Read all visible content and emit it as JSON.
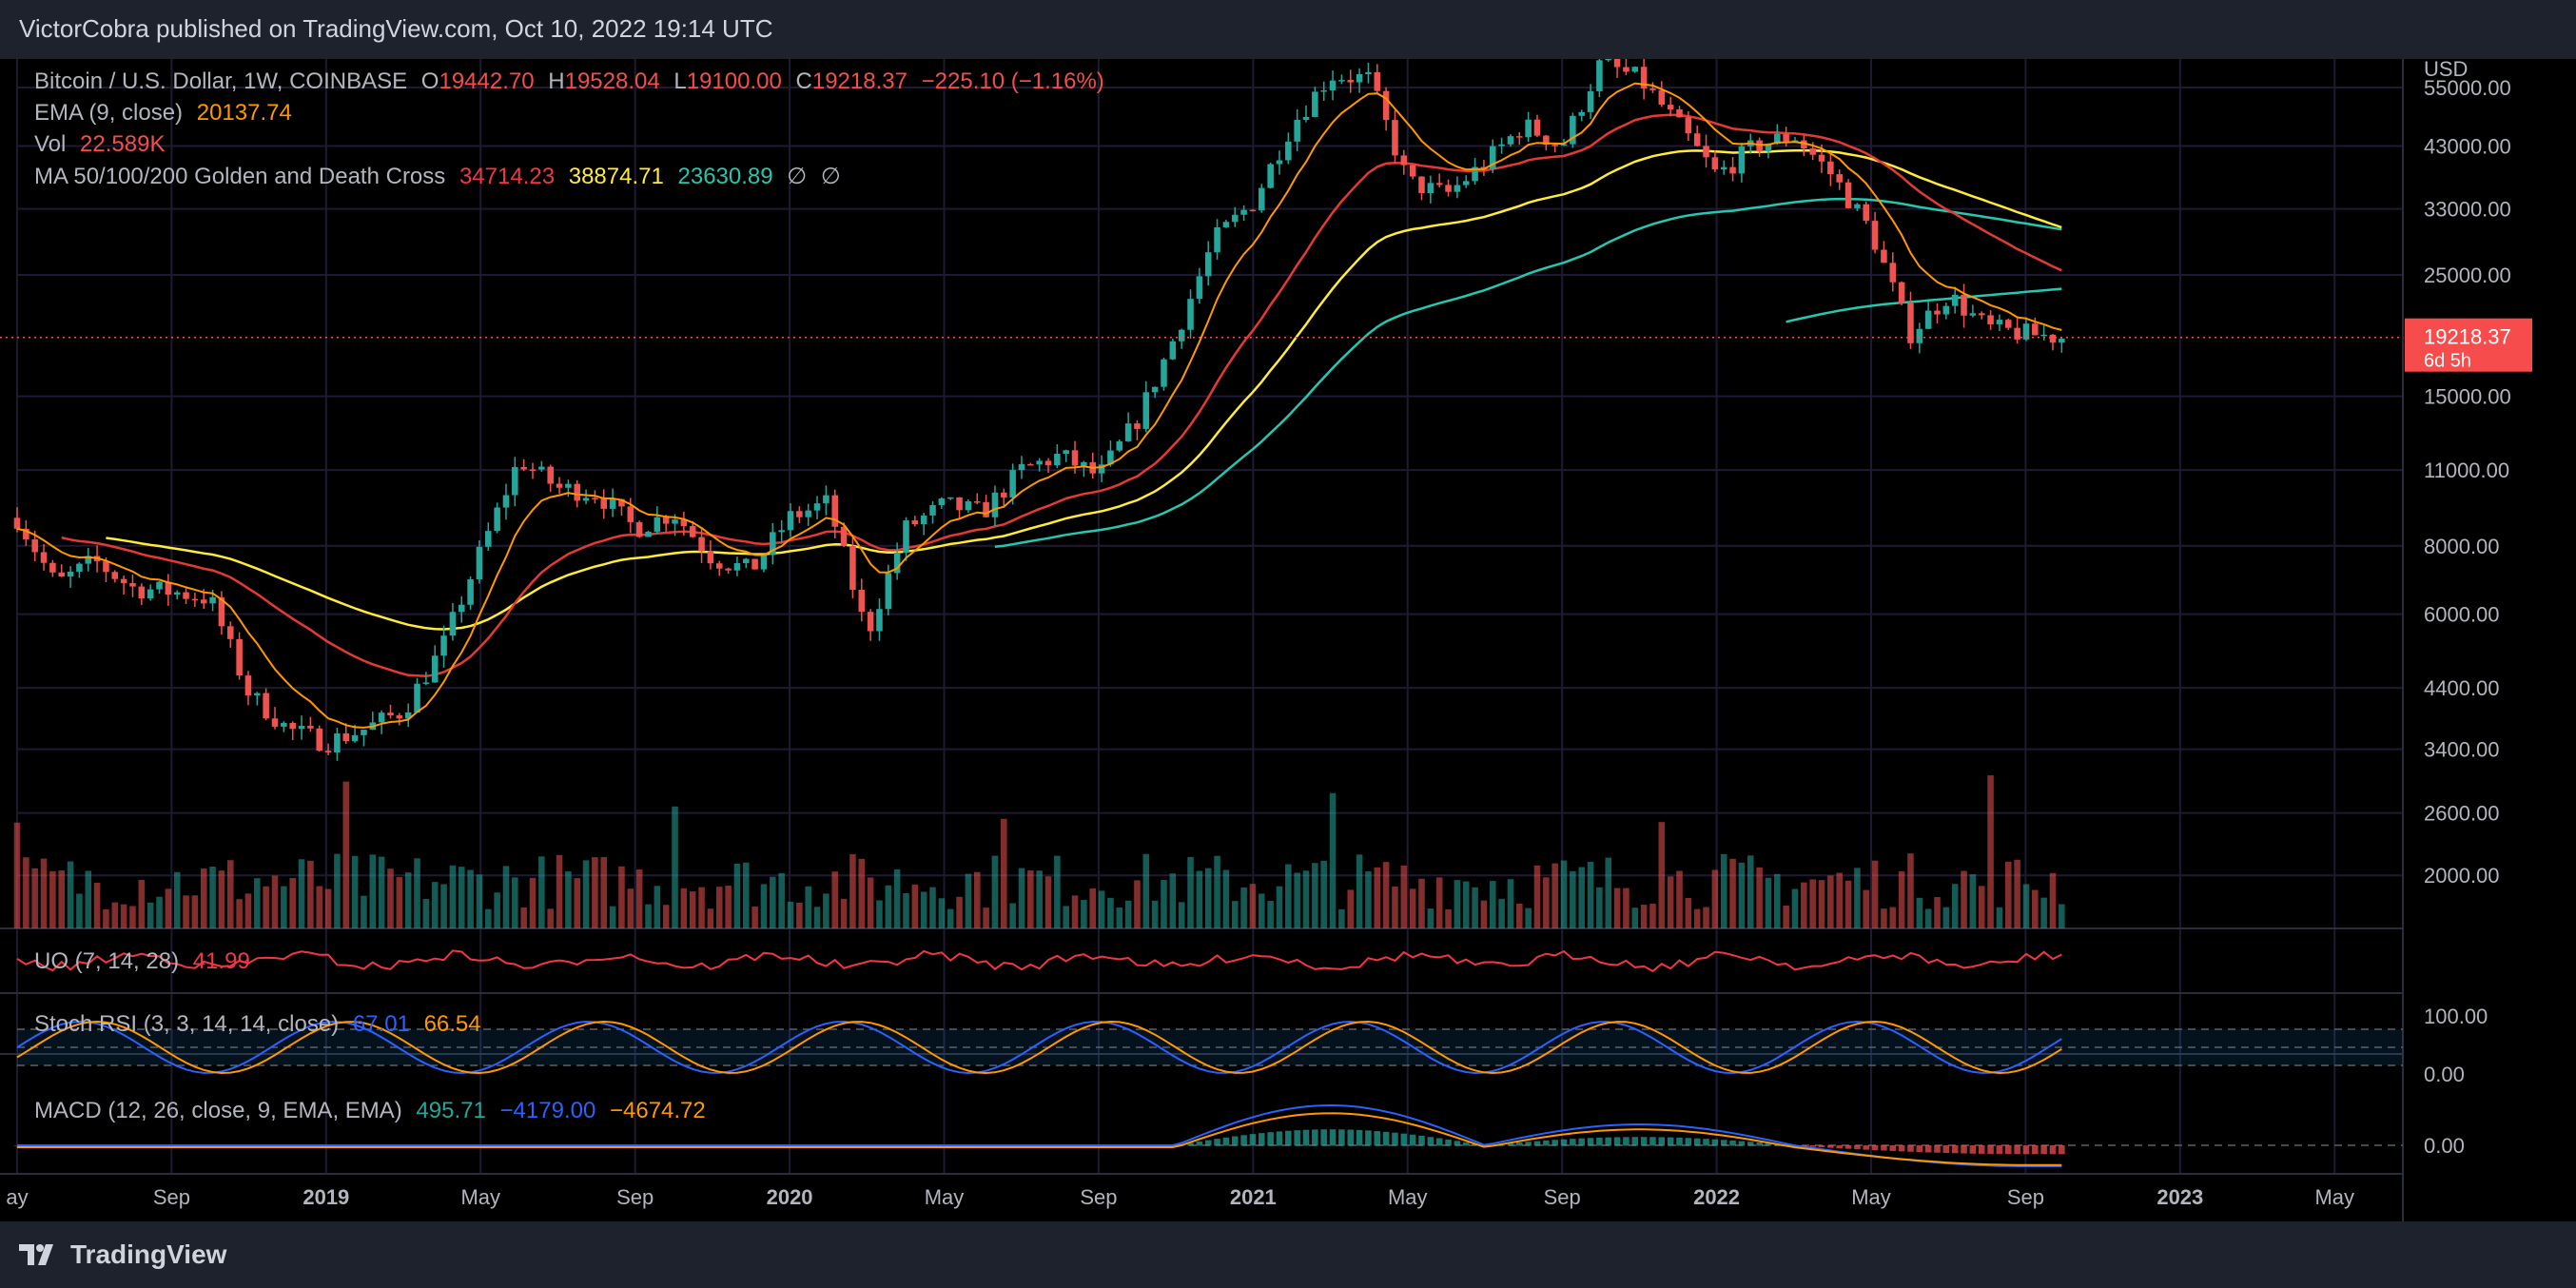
{
  "publisher": "VictorCobra published on TradingView.com, Oct 10, 2022 19:14 UTC",
  "brand": {
    "name": "TradingView",
    "logo_icon": "tradingview-logo-icon"
  },
  "colors": {
    "up": "#26a69a",
    "down": "#ef5350",
    "ema": "#ff9800",
    "ma50": "#e53935",
    "ma100": "#ffeb3b",
    "ma200": "#26c6b0",
    "macd": "#2962ff",
    "signal": "#ff9800",
    "uo": "#f23645",
    "accent": "#f74c4c"
  },
  "legend": {
    "symbol": "Bitcoin / U.S. Dollar, 1W, COINBASE",
    "o_label": "O",
    "o": "19442.70",
    "h_label": "H",
    "h": "19528.04",
    "l_label": "L",
    "l": "19100.00",
    "c_label": "C",
    "c": "19218.37",
    "change": "−225.10 (−1.16%)",
    "ema_label": "EMA (9, close)",
    "ema_value": "20137.74",
    "vol_label": "Vol",
    "vol_value": "22.589K",
    "ma_label": "MA 50/100/200 Golden and Death Cross",
    "ma50_value": "34714.23",
    "ma100_value": "38874.71",
    "ma200_value": "23630.89",
    "na1": "∅",
    "na2": "∅"
  },
  "uo": {
    "label": "UO (7, 14, 28)",
    "value": "41.99"
  },
  "stoch": {
    "label": "Stoch RSI (3, 3, 14, 14, close)",
    "k": "67.01",
    "d": "66.54"
  },
  "macd": {
    "label": "MACD (12, 26, close, 9, EMA, EMA)",
    "hist": "495.71",
    "macd": "−4179.00",
    "signal": "−4674.72"
  },
  "price_scale": {
    "currency": "USD",
    "current_price": "19218.37",
    "countdown": "6d 5h"
  },
  "chart_data": {
    "type": "candlestick",
    "interval": "1W",
    "price_axis": {
      "scale": "log",
      "ticks": [
        2000,
        2600,
        3400,
        4400,
        6000,
        8000,
        11000,
        15000,
        25000,
        33000,
        43000,
        55000
      ],
      "tick_labels": [
        "2000.00",
        "2600.00",
        "3400.00",
        "4400.00",
        "6000.00",
        "8000.00",
        "11000.00",
        "15000.00",
        "25000.00",
        "33000.00",
        "43000.00",
        "55000.00"
      ]
    },
    "stoch_axis": {
      "tick_labels": [
        "100.00",
        "0.00"
      ]
    },
    "macd_axis": {
      "tick_labels": [
        "0.00"
      ]
    },
    "time_axis": {
      "labels": [
        "ay",
        "Sep",
        "2019",
        "May",
        "Sep",
        "2020",
        "May",
        "Sep",
        "2021",
        "May",
        "Sep",
        "2022",
        "May",
        "Sep",
        "2023",
        "May"
      ],
      "bold": [
        false,
        false,
        true,
        false,
        false,
        true,
        false,
        false,
        true,
        false,
        false,
        true,
        false,
        false,
        true,
        false
      ]
    },
    "price_anchors": [
      [
        "2018-05",
        9000
      ],
      [
        "2018-06",
        6800
      ],
      [
        "2018-07",
        7500
      ],
      [
        "2018-08",
        6700
      ],
      [
        "2018-09",
        6600
      ],
      [
        "2018-10",
        6400
      ],
      [
        "2018-11",
        4300
      ],
      [
        "2018-12",
        3700
      ],
      [
        "2019-01",
        3500
      ],
      [
        "2019-02",
        3700
      ],
      [
        "2019-03",
        4000
      ],
      [
        "2019-04",
        5200
      ],
      [
        "2019-05",
        7800
      ],
      [
        "2019-06",
        11500
      ],
      [
        "2019-07",
        10200
      ],
      [
        "2019-08",
        10000
      ],
      [
        "2019-09",
        8600
      ],
      [
        "2019-10",
        9200
      ],
      [
        "2019-11",
        7600
      ],
      [
        "2019-12",
        7200
      ],
      [
        "2020-01",
        9000
      ],
      [
        "2020-02",
        9600
      ],
      [
        "2020-03",
        5500
      ],
      [
        "2020-04",
        8600
      ],
      [
        "2020-05",
        9500
      ],
      [
        "2020-06",
        9200
      ],
      [
        "2020-07",
        11000
      ],
      [
        "2020-08",
        11700
      ],
      [
        "2020-09",
        10700
      ],
      [
        "2020-10",
        13600
      ],
      [
        "2020-11",
        19500
      ],
      [
        "2020-12",
        29000
      ],
      [
        "2021-01",
        34000
      ],
      [
        "2021-02",
        47000
      ],
      [
        "2021-03",
        58000
      ],
      [
        "2021-04",
        57000
      ],
      [
        "2021-05",
        37000
      ],
      [
        "2021-06",
        35000
      ],
      [
        "2021-07",
        40000
      ],
      [
        "2021-08",
        47000
      ],
      [
        "2021-09",
        43000
      ],
      [
        "2021-10",
        61000
      ],
      [
        "2021-11",
        57000
      ],
      [
        "2021-12",
        47000
      ],
      [
        "2022-01",
        38000
      ],
      [
        "2022-02",
        43000
      ],
      [
        "2022-03",
        45000
      ],
      [
        "2022-04",
        38000
      ],
      [
        "2022-05",
        30000
      ],
      [
        "2022-06",
        19500
      ],
      [
        "2022-07",
        23000
      ],
      [
        "2022-08",
        20000
      ],
      [
        "2022-09",
        19500
      ],
      [
        "2022-10",
        19218.37
      ]
    ]
  }
}
